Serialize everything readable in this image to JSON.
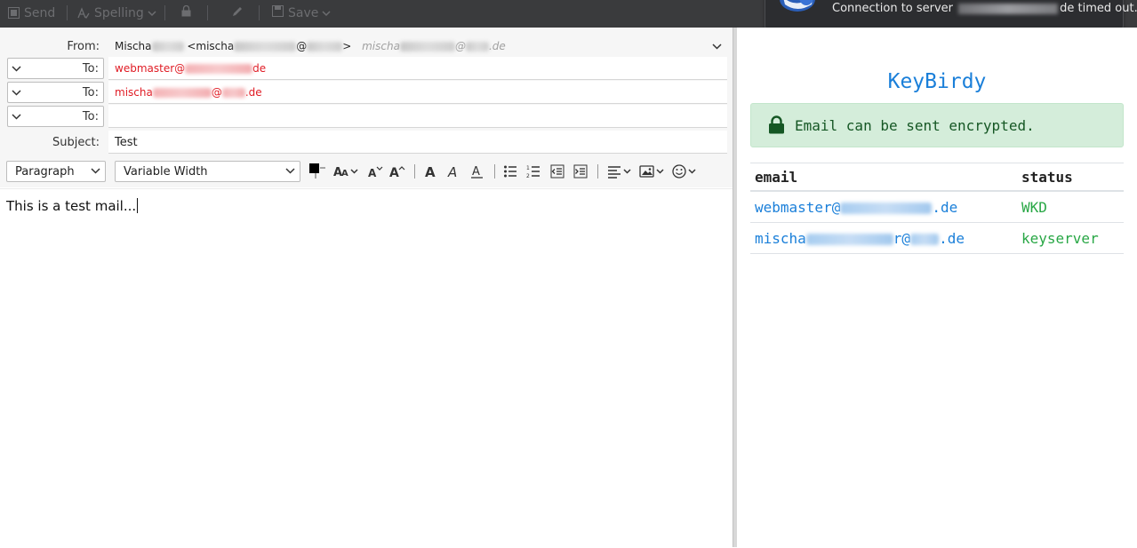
{
  "toolbar": {
    "send": "Send",
    "spelling": "Spelling",
    "save": "Save"
  },
  "notification": {
    "text_prefix": "Connection to server",
    "text_suffix": "de timed out."
  },
  "compose": {
    "from_label": "From:",
    "from_name": "Mischa",
    "from_addr_prefix": "<mischa",
    "from_addr_at": "@",
    "from_addr_suffix": ">",
    "from_identity": "mischa",
    "from_identity_mid": "@",
    "from_identity_tld": ".de",
    "recipients": [
      {
        "label": "To:",
        "prefix": "webmaster@",
        "suffix": "de"
      },
      {
        "label": "To:",
        "prefix": "mischa",
        "mid": "@",
        "suffix": ".de"
      },
      {
        "label": "To:",
        "prefix": "",
        "suffix": ""
      }
    ],
    "subject_label": "Subject:",
    "subject": "Test",
    "paragraph_select": "Paragraph",
    "font_select": "Variable Width",
    "body": "This is a test mail..."
  },
  "keybirdy": {
    "title": "KeyBirdy",
    "alert": "Email can be sent encrypted.",
    "col_email": "email",
    "col_status": "status",
    "rows": [
      {
        "email_prefix": "webmaster@",
        "email_suffix": ".de",
        "status": "WKD"
      },
      {
        "email_prefix": "mischa",
        "email_mid": "r@",
        "email_suffix": ".de",
        "status": "keyserver"
      }
    ]
  },
  "colors": {
    "toolbar_bg": "#3a3b3d",
    "accent_blue": "#1a7fd9",
    "recipient_red": "#e01b24",
    "success_green": "#28a745",
    "alert_bg": "#d4edda"
  }
}
